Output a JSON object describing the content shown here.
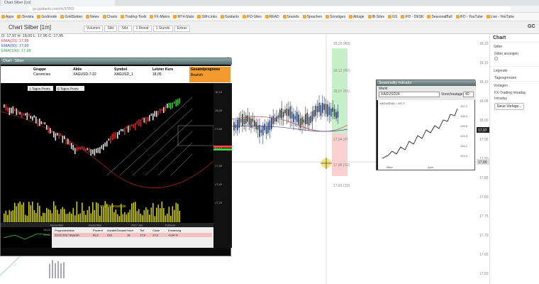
{
  "browser": {
    "tab": "Chart Silber [1m]",
    "url": "go.guidants.com/#c/37803",
    "bookmarks": [
      "Apps",
      "Onvista",
      "Godmode",
      "GoldSeiten",
      "News",
      "Charts",
      "Trading-Tools",
      "FX-Makro",
      "MT4-Stats",
      "GM-Links",
      "Guidants",
      "IFD-Sites",
      "READ",
      "Sounds",
      "Sprachen",
      "Sonstiges",
      "Ablage",
      "IB-Sites",
      "GS",
      "IFD - DESK",
      "SeasonalBull",
      "IFD - YouTube",
      "Live - YouTube"
    ]
  },
  "app": {
    "title": "Chart Silber [1m]",
    "corner": "GC",
    "toolbar": [
      "Volumen",
      "Stkt.",
      "Stkt.",
      "1 Monat",
      "1 Stunde",
      "Extras"
    ],
    "info": [
      "O: 17,97  H: 18,00  L: 17,95  C: 17,95",
      "EMA(20): 17,98",
      "EMA(50): 17,99",
      "EMA(100): 17,98"
    ]
  },
  "sidebar": {
    "title": "Chart",
    "items": [
      "Gitter",
      "Gitter anzeigen",
      "Legende",
      "Tagesgrenzen",
      "Vorlagen",
      "FX-Trading Intraday",
      "Intraday"
    ],
    "new_btn": "Neue Vorlage..."
  },
  "price_axis": [
    "18,20",
    "18,15",
    "18,10",
    "18,05",
    "18,00",
    "17,95",
    "17,90",
    "17,85",
    "17,80",
    "17,75",
    "17,70",
    "17,65",
    "17,60"
  ],
  "price_current": "17,97",
  "price_marker": "17,89",
  "pivots": [
    {
      "label": "18,20 (R3)",
      "color": "#888"
    },
    {
      "label": "18,12 (R2)",
      "color": "#888"
    },
    {
      "label": "18,07 (R1)",
      "color": "#888"
    },
    {
      "label": "17,94 (P)",
      "color": "#888"
    },
    {
      "label": "17,86 (S2)",
      "color": "#888"
    },
    {
      "label": "17,81 (S3)",
      "color": "#888"
    }
  ],
  "win": {
    "title": "Chart · Silber",
    "menu": [
      "Datei",
      "Ansicht",
      "Extras"
    ],
    "headers": [
      "Gruppe",
      "Aktie",
      "Symbol",
      "Letzter Kurs",
      "Gesamtprognose"
    ],
    "values": [
      "Currencies",
      "XAGUSD-7-22",
      "XAGUSD_1",
      "18,05",
      "Bearish"
    ],
    "pivot_tabs": [
      "1-Tages-Pivots",
      "5-Tages-Pivots"
    ],
    "watermark": "www.forecast.de",
    "months": [
      "November",
      "Dezember",
      "2017 Jan",
      "Februar"
    ],
    "table_head": [
      "Prognosedatum",
      "Prozent",
      "Anzahl/Gesamt",
      "Hoch",
      "Tief",
      "Close",
      "Erwartung"
    ],
    "table_row": [
      "23.02.2017 Bearish",
      "60,2",
      "216",
      "18",
      "17,9",
      "17,9",
      "-0,94 %"
    ],
    "mini_prices": [
      "18,03",
      "17,95"
    ],
    "scale": [
      "18,15",
      "18,00",
      "17,85",
      "17,70",
      "17,55",
      "17,40",
      "17,25"
    ]
  },
  "small": {
    "title": "Seasonality Indicator",
    "label1": "Markt",
    "market": "XAGUSD24",
    "label2": "Vorschautage",
    "days": "40",
    "legend": "XAGUSD24 = 107,7",
    "xlabels": [
      "März",
      "April"
    ],
    "ylabels": [
      "107,1",
      "106,4",
      "105,6",
      "104,9",
      "104,1",
      "103,4"
    ]
  }
}
